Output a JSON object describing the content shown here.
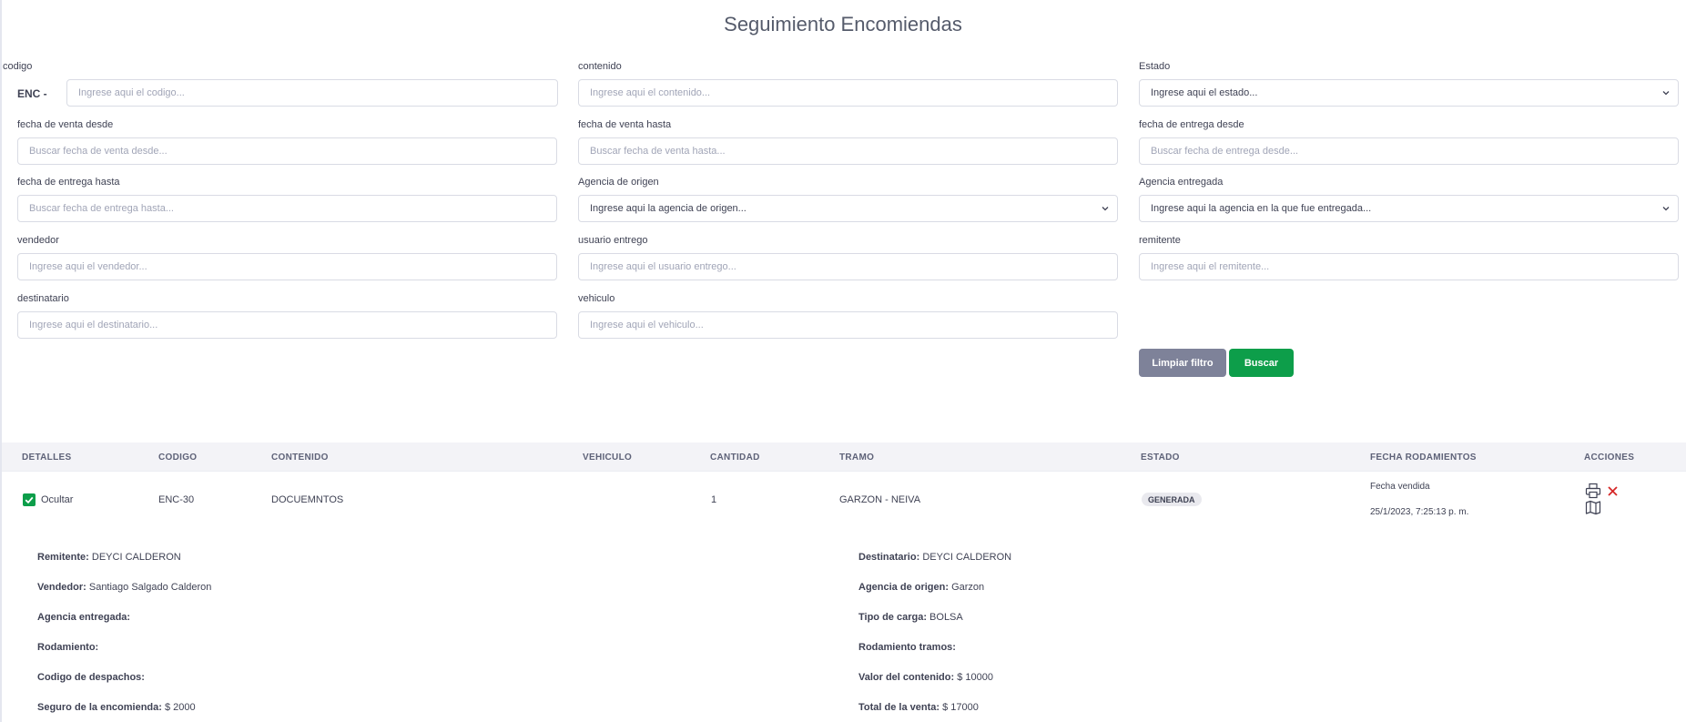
{
  "page": {
    "title": "Seguimiento Encomiendas"
  },
  "filters": {
    "codigo": {
      "label": "codigo",
      "prefix": "ENC -",
      "placeholder": "Ingrese aqui el codigo..."
    },
    "contenido": {
      "label": "contenido",
      "placeholder": "Ingrese aqui el contenido..."
    },
    "estado": {
      "label": "Estado",
      "value": "Ingrese aqui el estado..."
    },
    "fecha_venta_desde": {
      "label": "fecha de venta desde",
      "placeholder": "Buscar fecha de venta desde..."
    },
    "fecha_venta_hasta": {
      "label": "fecha de venta hasta",
      "placeholder": "Buscar fecha de venta hasta..."
    },
    "fecha_entrega_desde": {
      "label": "fecha de entrega desde",
      "placeholder": "Buscar fecha de entrega desde..."
    },
    "fecha_entrega_hasta": {
      "label": "fecha de entrega hasta",
      "placeholder": "Buscar fecha de entrega hasta..."
    },
    "agencia_origen": {
      "label": "Agencia de origen",
      "value": "Ingrese aqui la agencia de origen..."
    },
    "agencia_entregada": {
      "label": "Agencia entregada",
      "value": "Ingrese aqui la agencia en la que fue entregada..."
    },
    "vendedor": {
      "label": "vendedor",
      "placeholder": "Ingrese aqui el vendedor..."
    },
    "usuario_entrego": {
      "label": "usuario entrego",
      "placeholder": "Ingrese aqui el usuario entrego..."
    },
    "remitente": {
      "label": "remitente",
      "placeholder": "Ingrese aqui el remitente..."
    },
    "destinatario": {
      "label": "destinatario",
      "placeholder": "Ingrese aqui el destinatario..."
    },
    "vehiculo": {
      "label": "vehiculo",
      "placeholder": "Ingrese aqui el vehiculo..."
    }
  },
  "buttons": {
    "clear": "Limpiar filtro",
    "search": "Buscar"
  },
  "colors": {
    "primary_green": "#0d9e4a",
    "clear_gray": "#7e8299",
    "danger_red": "#d62828"
  },
  "table": {
    "headers": [
      "DETALLES",
      "CODIGO",
      "CONTENIDO",
      "VEHICULO",
      "CANTIDAD",
      "TRAMO",
      "ESTADO",
      "FECHA RODAMIENTOS",
      "ACCIONES"
    ],
    "row": {
      "detalles": "Ocultar",
      "codigo": "ENC-30",
      "contenido": "DOCUEMNTOS",
      "vehiculo": "",
      "cantidad": "1",
      "tramo": "GARZON - NEIVA",
      "estado": "GENERADA",
      "fecha_label": "Fecha vendida",
      "fecha_value": "25/1/2023, 7:25:13 p. m."
    }
  },
  "details": {
    "left": [
      {
        "label": "Remitente:",
        "value": "DEYCI CALDERON"
      },
      {
        "label": "Vendedor:",
        "value": "Santiago Salgado Calderon"
      },
      {
        "label": "Agencia entregada:",
        "value": ""
      },
      {
        "label": "Rodamiento:",
        "value": ""
      },
      {
        "label": "Codigo de despachos:",
        "value": ""
      },
      {
        "label": "Seguro de la encomienda:",
        "value": "$ 2000"
      }
    ],
    "right": [
      {
        "label": "Destinatario:",
        "value": "DEYCI CALDERON"
      },
      {
        "label": "Agencia de origen:",
        "value": "Garzon"
      },
      {
        "label": "Tipo de carga:",
        "value": "BOLSA"
      },
      {
        "label": "Rodamiento tramos:",
        "value": ""
      },
      {
        "label": "Valor del contenido:",
        "value": "$ 10000"
      },
      {
        "label": "Total de la venta:",
        "value": "$ 17000"
      }
    ]
  },
  "icons": {
    "print": "printer-icon",
    "delete": "close-icon",
    "map": "map-icon",
    "check": "check-icon",
    "chevron": "chevron-down-icon"
  }
}
